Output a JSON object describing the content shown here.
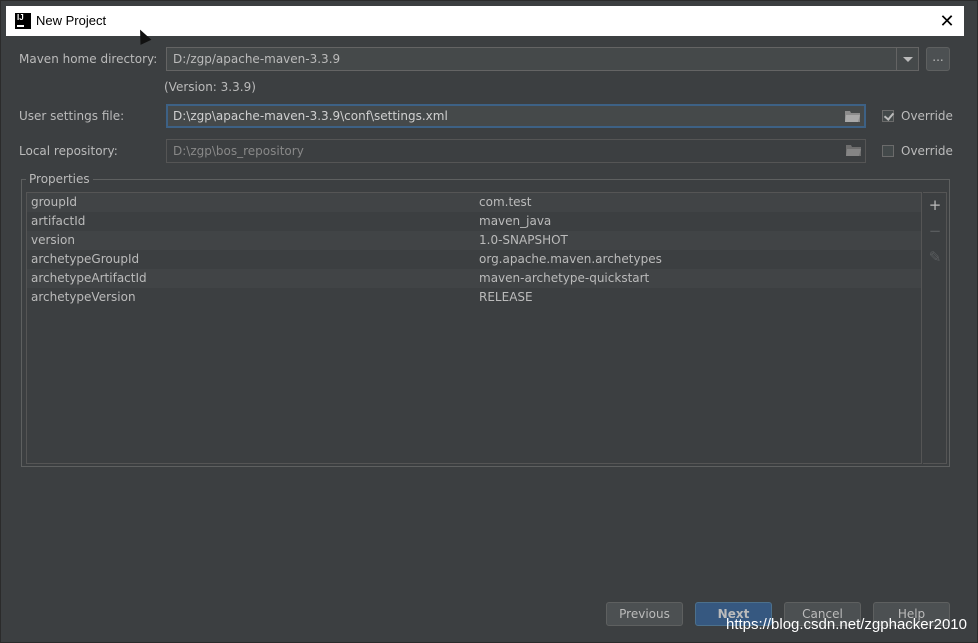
{
  "window": {
    "title": "New Project"
  },
  "maven_home": {
    "label": "Maven home directory:",
    "value": "D:/zgp/apache-maven-3.3.9",
    "version_note": "(Version: 3.3.9)",
    "browse_label": "..."
  },
  "user_settings": {
    "label": "User settings file:",
    "value": "D:\\zgp\\apache-maven-3.3.9\\conf\\settings.xml",
    "override_label": "Override",
    "override_checked": true
  },
  "local_repo": {
    "label": "Local repository:",
    "value": "D:\\zgp\\bos_repository",
    "override_label": "Override",
    "override_checked": false
  },
  "properties": {
    "title": "Properties",
    "rows": [
      {
        "key": "groupId",
        "value": "com.test"
      },
      {
        "key": "artifactId",
        "value": "maven_java"
      },
      {
        "key": "version",
        "value": "1.0-SNAPSHOT"
      },
      {
        "key": "archetypeGroupId",
        "value": "org.apache.maven.archetypes"
      },
      {
        "key": "archetypeArtifactId",
        "value": "maven-archetype-quickstart"
      },
      {
        "key": "archetypeVersion",
        "value": "RELEASE"
      }
    ]
  },
  "buttons": {
    "previous": "Previous",
    "next": "Next",
    "cancel": "Cancel",
    "help": "Help"
  },
  "watermark": "https://blog.csdn.net/zgphacker2010"
}
